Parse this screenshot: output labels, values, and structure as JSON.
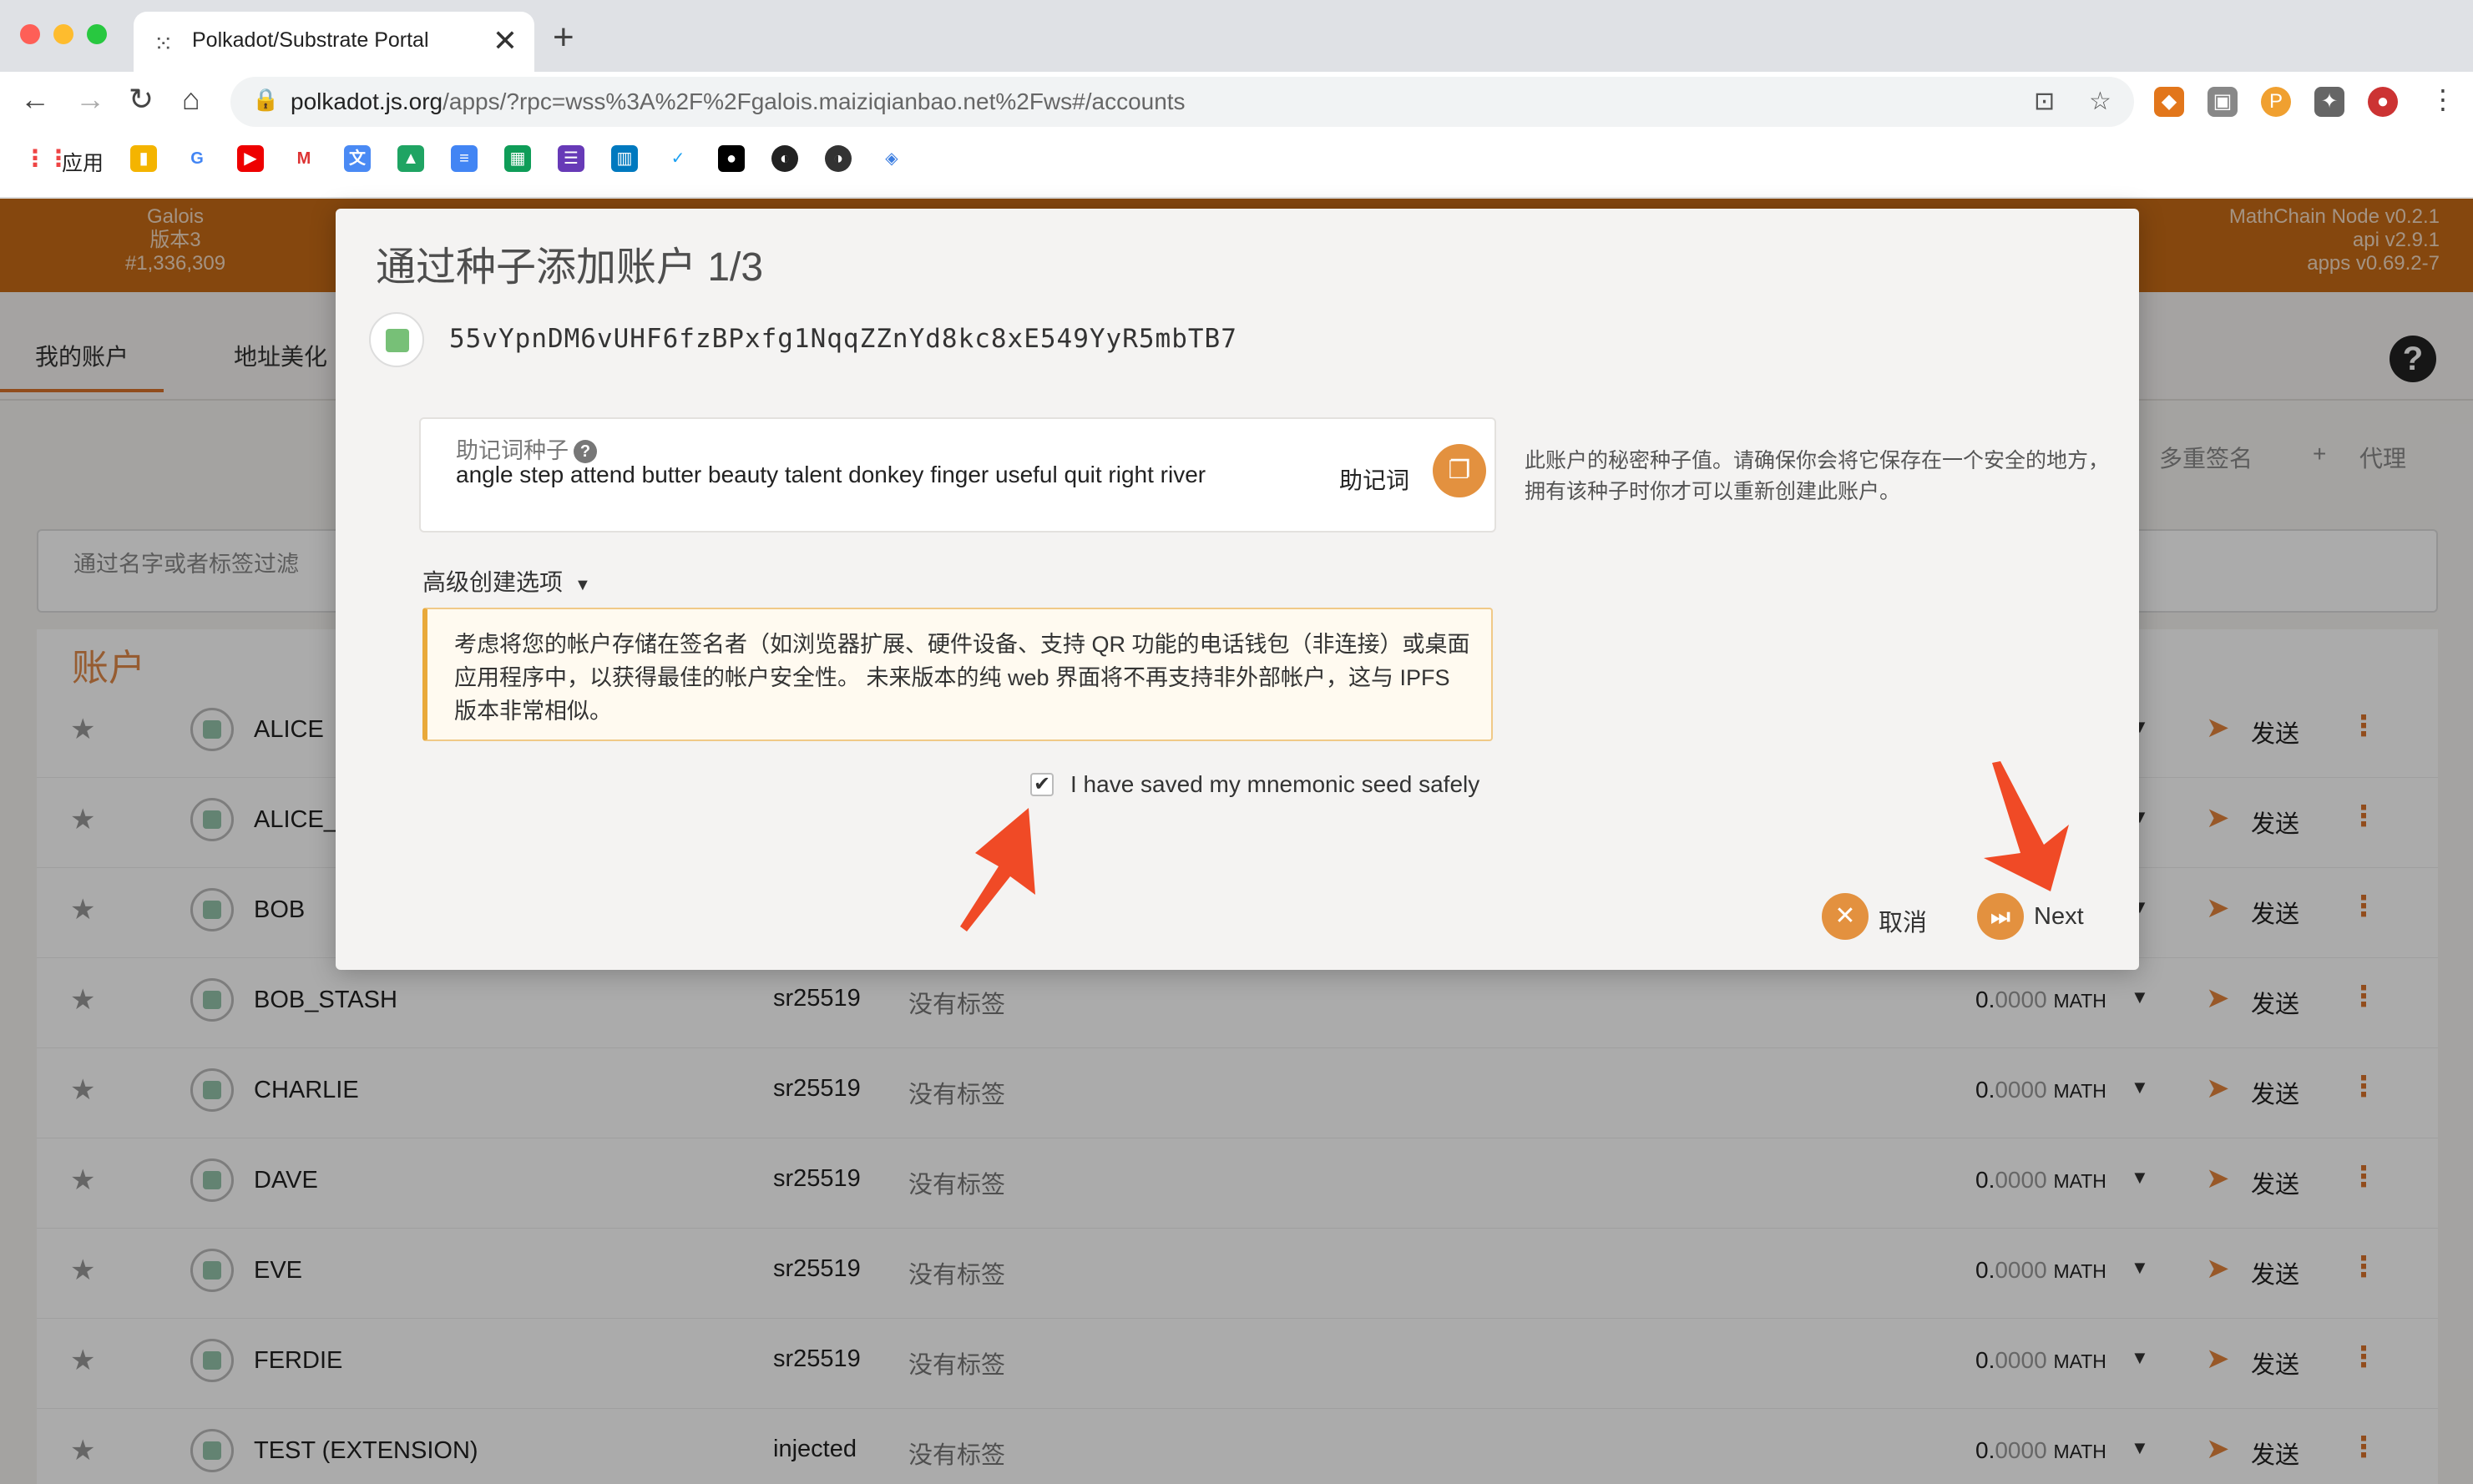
{
  "browser": {
    "tab_title": "Polkadot/Substrate Portal",
    "tab_close": "✕",
    "new_tab": "+",
    "url_host": "polkadot.js.org",
    "url_path": "/apps/?rpc=wss%3A%2F%2Fgalois.maiziqianbao.net%2Fws#/accounts",
    "bookmarks_apps_label": "应用"
  },
  "app": {
    "chain": {
      "name": "Galois",
      "version": "版本3",
      "block": "#1,336,309"
    },
    "node": {
      "node_version": "MathChain Node v0.2.1",
      "api_version": "api v2.9.1",
      "apps_version": "apps v0.69.2-7"
    },
    "subnav": {
      "tab_my_accounts": "我的账户",
      "tab_vanity": "地址美化",
      "help": "?"
    },
    "actions": {
      "multisig": "多重签名",
      "proxy": "代理",
      "proxy_plus": "+"
    },
    "filter_placeholder": "通过名字或者标签过滤",
    "accounts_title": "账户",
    "accounts": [
      {
        "name": "ALICE",
        "type": "",
        "tags": "",
        "balance_int": "",
        "balance_frac": "",
        "unit": ""
      },
      {
        "name": "ALICE_S",
        "type": "",
        "tags": "",
        "balance_int": "",
        "balance_frac": "",
        "unit": ""
      },
      {
        "name": "BOB",
        "type": "",
        "tags": "",
        "balance_int": "",
        "balance_frac": "",
        "unit": ""
      },
      {
        "name": "BOB_STASH",
        "type": "sr25519",
        "tags": "没有标签",
        "balance_int": "0.",
        "balance_frac": "0000",
        "unit": "MATH"
      },
      {
        "name": "CHARLIE",
        "type": "sr25519",
        "tags": "没有标签",
        "balance_int": "0.",
        "balance_frac": "0000",
        "unit": "MATH"
      },
      {
        "name": "DAVE",
        "type": "sr25519",
        "tags": "没有标签",
        "balance_int": "0.",
        "balance_frac": "0000",
        "unit": "MATH"
      },
      {
        "name": "EVE",
        "type": "sr25519",
        "tags": "没有标签",
        "balance_int": "0.",
        "balance_frac": "0000",
        "unit": "MATH"
      },
      {
        "name": "FERDIE",
        "type": "sr25519",
        "tags": "没有标签",
        "balance_int": "0.",
        "balance_frac": "0000",
        "unit": "MATH"
      },
      {
        "name": "TEST (EXTENSION)",
        "type": "injected",
        "tags": "没有标签",
        "balance_int": "0.",
        "balance_frac": "0000",
        "unit": "MATH"
      }
    ],
    "send_label": "发送"
  },
  "modal": {
    "title": "通过种子添加账户 1/3",
    "address": "55vYpnDM6vUHF6fzBPxfg1NqqZZnYd8kc8xE549YyR5mbTB7",
    "seed_label": "助记词种子",
    "seed_help_icon": "?",
    "seed_value": "angle step attend butter beauty talent donkey finger useful quit right river",
    "seed_type": "助记词",
    "seed_help_text": "此账户的秘密种子值。请确保你会将它保存在一个安全的地方，拥有该种子时你才可以重新创建此账户。",
    "advanced_label": "高级创建选项",
    "warning_text": "考虑将您的帐户存储在签名者（如浏览器扩展、硬件设备、支持 QR 功能的电话钱包（非连接）或桌面应用程序中，以获得最佳的帐户安全性。 未来版本的纯 web 界面将不再支持非外部帐户，这与 IPFS 版本非常相似。",
    "confirm_label": "I have saved my mnemonic seed safely",
    "confirm_checked": true,
    "cancel_label": "取消",
    "next_label": "Next"
  },
  "colors": {
    "accent": "#e3913f",
    "header": "#c66a15",
    "annotation_arrow": "#f04a26"
  }
}
